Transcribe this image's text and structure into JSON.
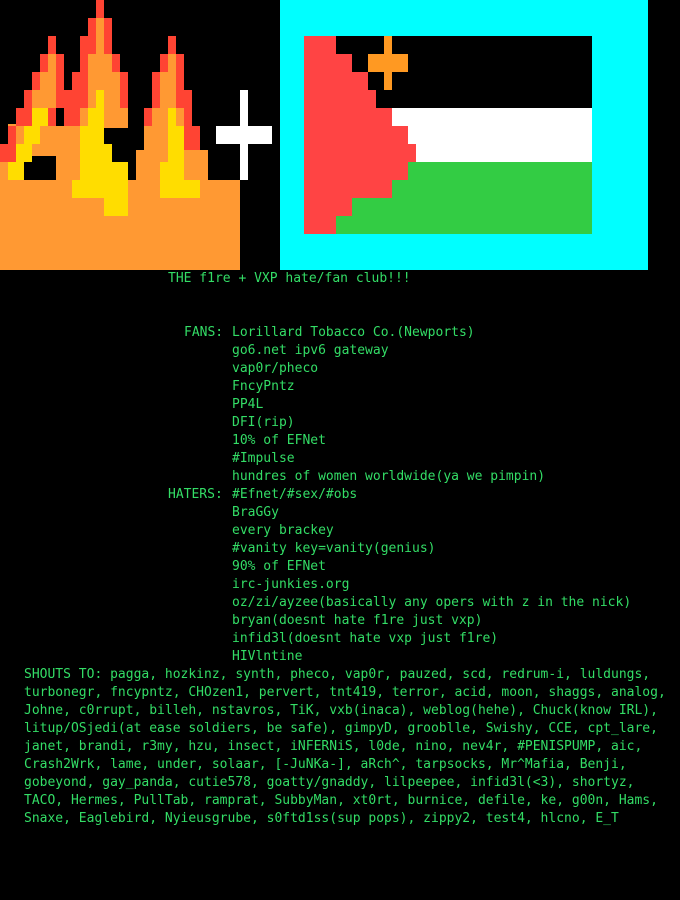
{
  "colors": {
    "background": "#000000",
    "text": "#33dd66",
    "flame_red": "#ff4433",
    "flame_orange": "#ff9933",
    "flame_yellow": "#ffdd00",
    "flag_border": "#00ffff",
    "flag_red": "#ff4444",
    "flag_black": "#000000",
    "flag_white": "#ffffff",
    "flag_green": "#33cc44",
    "flag_cross": "#ff9922",
    "plus_sign": "#ffffff"
  },
  "banner": {
    "left_icon": "pixel-flames-icon",
    "middle_icon": "plus-icon",
    "right_icon": "pixel-flag-with-cross-icon"
  },
  "title": "THE f1re + VXP hate/fan club!!!",
  "fans": {
    "label": "FANS:",
    "items": [
      "Lorillard Tobacco Co.(Newports)",
      "go6.net ipv6 gateway",
      "vap0r/pheco",
      "FncyPntz",
      "PP4L",
      "DFI(rip)",
      "10% of EFNet",
      "#Impulse",
      "hundres of women worldwide(ya we pimpin)"
    ]
  },
  "haters": {
    "label": "HATERS:",
    "items": [
      "#Efnet/#sex/#obs",
      "BraGGy",
      "every brackey",
      "#vanity key=vanity(genius)",
      "90% of EFNet",
      "irc-junkies.org",
      "oz/zi/ayzee(basically any opers with z in the nick)",
      "bryan(doesnt hate f1re just vxp)",
      "infid3l(doesnt hate vxp just f1re)",
      "HIVlntine"
    ]
  },
  "shouts": {
    "lines": [
      "SHOUTS TO: pagga, hozkinz, synth, pheco, vap0r, pauzed, scd, redrum-i, luldungs,",
      "turbonegr, fncypntz, CHOzen1, pervert, tnt419, terror, acid, moon, shaggs, analog,",
      "Johne, c0rrupt, billeh, nstavros, TiK, vxb(inaca), weblog(hehe), Chuck(know IRL),",
      "litup/OSjedi(at ease soldiers, be safe), gimpyD, grooblle, Swishy, CCE, cpt_lare,",
      "janet, brandi, r3my, hzu, insect, iNFERNiS, l0de, nino, nev4r, #PENISPUMP, aic,",
      "Crash2Wrk, lame, under, solaar, [-JuNKa-], aRch^, tarpsocks, Mr^Mafia, Benji,",
      "gobeyond, gay_panda, cutie578, goatty/gnaddy, lilpeepee, infid3l(<3), shortyz,",
      "TACO, Hermes, PullTab, ramprat, SubbyMan, xt0rt, burnice, defile, ke, g00n, Hams,",
      "Snaxe, Eaglebird, Nyieusgrube, s0ftd1ss(sup pops), zippy2, test4, hlcno, E_T"
    ]
  }
}
